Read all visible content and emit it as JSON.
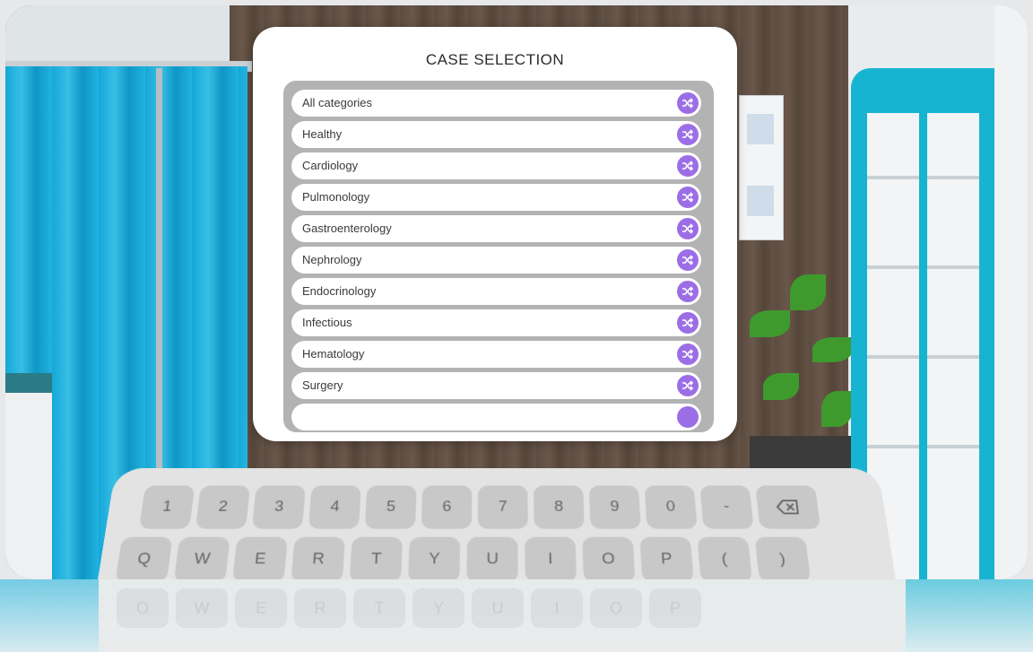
{
  "panel": {
    "title": "CASE SELECTION",
    "categories": [
      "All categories",
      "Healthy",
      "Cardiology",
      "Pulmonology",
      "Gastroenterology",
      "Nephrology",
      "Endocrinology",
      "Infectious",
      "Hematology",
      "Surgery"
    ],
    "shuffle_icon": "shuffle-icon",
    "accent_color": "#9c6ee6"
  },
  "keyboard": {
    "row1": [
      "1",
      "2",
      "3",
      "4",
      "5",
      "6",
      "7",
      "8",
      "9",
      "0",
      "-"
    ],
    "backspace_icon": "backspace-icon",
    "row2": [
      "Q",
      "W",
      "E",
      "R",
      "T",
      "Y",
      "U",
      "I",
      "O",
      "P",
      "(",
      ")"
    ]
  }
}
